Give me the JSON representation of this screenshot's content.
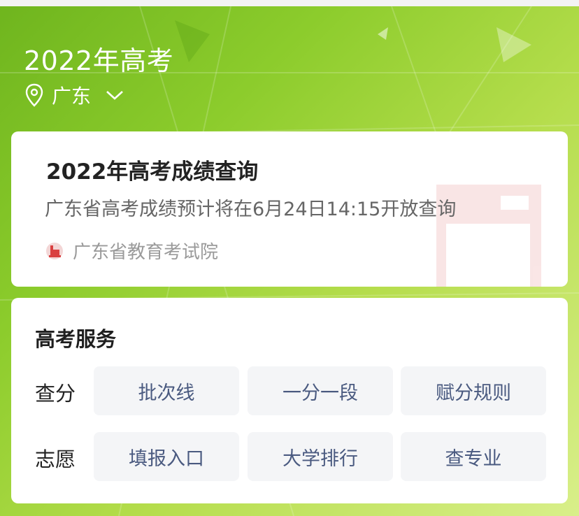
{
  "header": {
    "title": "2022年高考",
    "location": "广东"
  },
  "notice": {
    "title": "2022年高考成绩查询",
    "description": "广东省高考成绩预计将在6月24日14:15开放查询",
    "source": "广东省教育考试院"
  },
  "services": {
    "title": "高考服务",
    "rows": [
      {
        "label": "查分",
        "buttons": [
          "批次线",
          "一分一段",
          "赋分规则"
        ]
      },
      {
        "label": "志愿",
        "buttons": [
          "填报入口",
          "大学排行",
          "查专业"
        ]
      }
    ]
  },
  "colors": {
    "background_green": "#8ccc2c",
    "button_text": "#4a5a80",
    "button_bg": "#f4f5f7",
    "source_logo_red": "#d94040"
  },
  "icons": [
    "location-pin-icon",
    "chevron-down-icon",
    "exam-authority-logo-icon"
  ]
}
